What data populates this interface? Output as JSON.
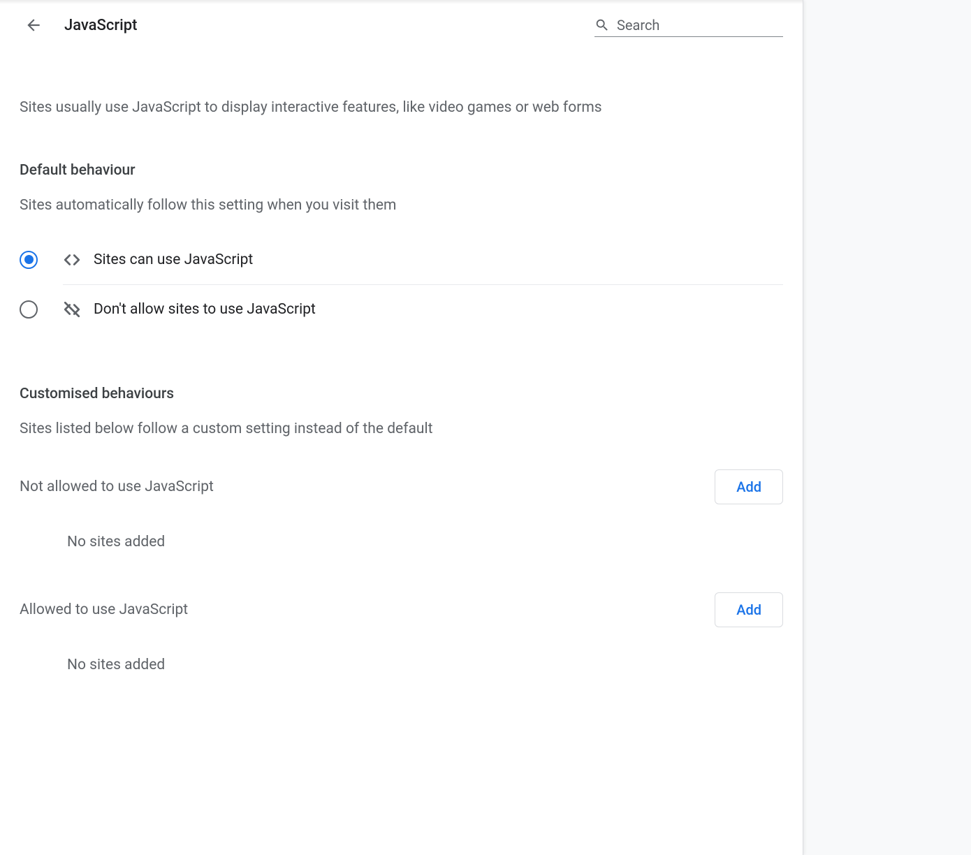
{
  "header": {
    "title": "JavaScript",
    "search_placeholder": "Search"
  },
  "intro": "Sites usually use JavaScript to display interactive features, like video games or web forms",
  "default_behaviour": {
    "title": "Default behaviour",
    "subtitle": "Sites automatically follow this setting when you visit them",
    "options": [
      {
        "label": "Sites can use JavaScript",
        "checked": true
      },
      {
        "label": "Don't allow sites to use JavaScript",
        "checked": false
      }
    ]
  },
  "customised": {
    "title": "Customised behaviours",
    "subtitle": "Sites listed below follow a custom setting instead of the default",
    "lists": [
      {
        "title": "Not allowed to use JavaScript",
        "add_label": "Add",
        "empty_text": "No sites added"
      },
      {
        "title": "Allowed to use JavaScript",
        "add_label": "Add",
        "empty_text": "No sites added"
      }
    ]
  }
}
